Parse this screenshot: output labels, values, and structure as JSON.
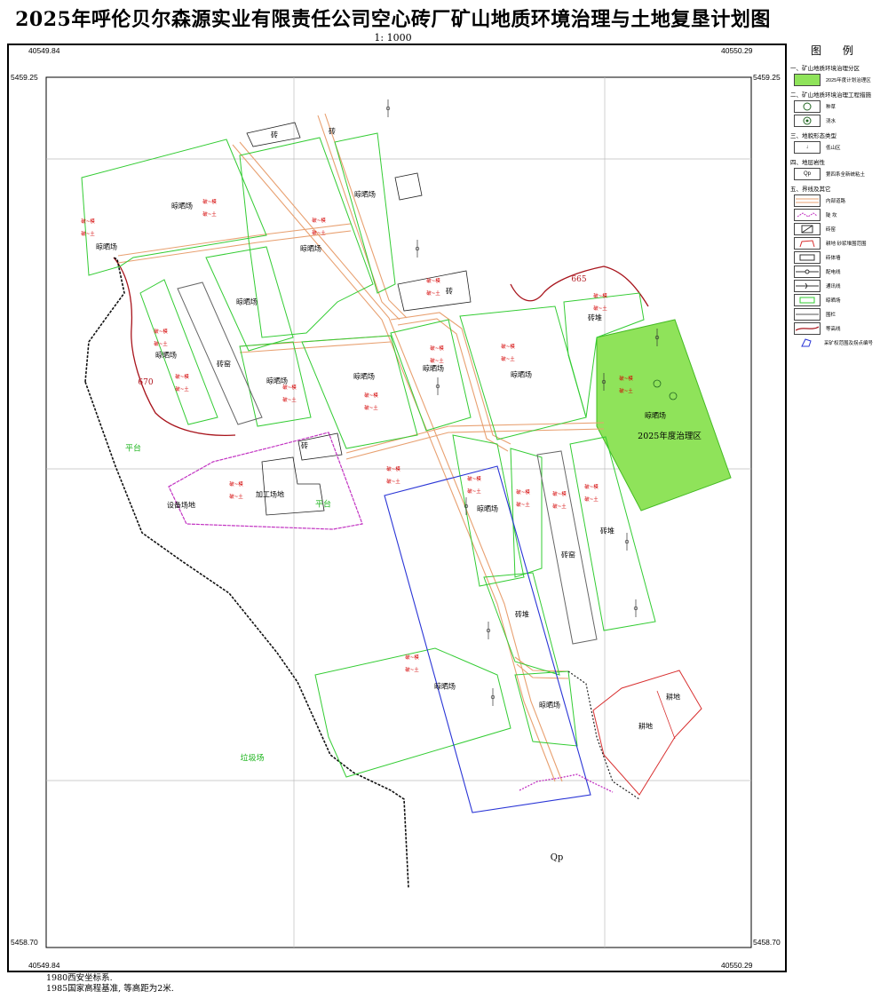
{
  "title": "2025年呼伦贝尔森源实业有限责任公司空心砖厂矿山地质环境治理与土地复垦计划图",
  "scale": "1:  1000",
  "coordinates": {
    "top_left_x": "40549.84",
    "top_right_x": "40550.29",
    "bottom_left_x": "40549.84",
    "bottom_right_x": "40550.29",
    "top_left_y": "5459.25",
    "top_right_y": "5459.25",
    "bottom_left_y": "5458.70",
    "bottom_right_y": "5458.70"
  },
  "notes": {
    "line1": "1980西安坐标系.",
    "line2": "1985国家高程基准, 等高距为2米."
  },
  "map_labels": {
    "shaichang": "晾晒场",
    "zhuanyao": "砖窑",
    "zhuan": "砖",
    "zhuandui": "砖堆",
    "jiagong": "加工场地",
    "shebei": "设备场地",
    "gengdi": "耕地",
    "pingtai": "平台",
    "lajichang": "垃圾场",
    "treat_zone": "2025年度治理区",
    "qp": "Qp",
    "contour_670": "670",
    "contour_665": "665",
    "red_a": "破~模",
    "red_b": "破~土"
  },
  "legend": {
    "title": "图  例",
    "sec1": "一、矿山地质环境治理分区",
    "item_zone": "2025年度计划治理区",
    "sec2": "二、矿山地质环境治理工程措施",
    "item_tree": "种草",
    "item_water": "浇水",
    "sec3": "三、地貌形态类型",
    "item_slope": "低山区",
    "sec4": "四、地层岩性",
    "item_qp": "第四系全新统粘土",
    "item_qp_sym": "Qp",
    "sec5": "五、界线及其它",
    "item_road": "内部道路",
    "item_slopeline": "陡 坎",
    "item_kiln": "砖窑",
    "item_farm": "耕地  砂浆堆围范围",
    "item_brick": "砖体墙",
    "item_power": "配电线",
    "item_comm": "通讯线",
    "item_dry": "晾晒场",
    "item_fence": "围栏",
    "item_contour": "等高线",
    "item_point": "采矿权范围及拐点编号"
  },
  "colors": {
    "treatment_fill": "#8fe35a",
    "green_line": "#33cc33",
    "road_line": "#e8a070",
    "contour": "#a8141c",
    "boundary_blue": "#2a35d6",
    "magenta": "#c233c2",
    "farm_red": "#d83030"
  }
}
